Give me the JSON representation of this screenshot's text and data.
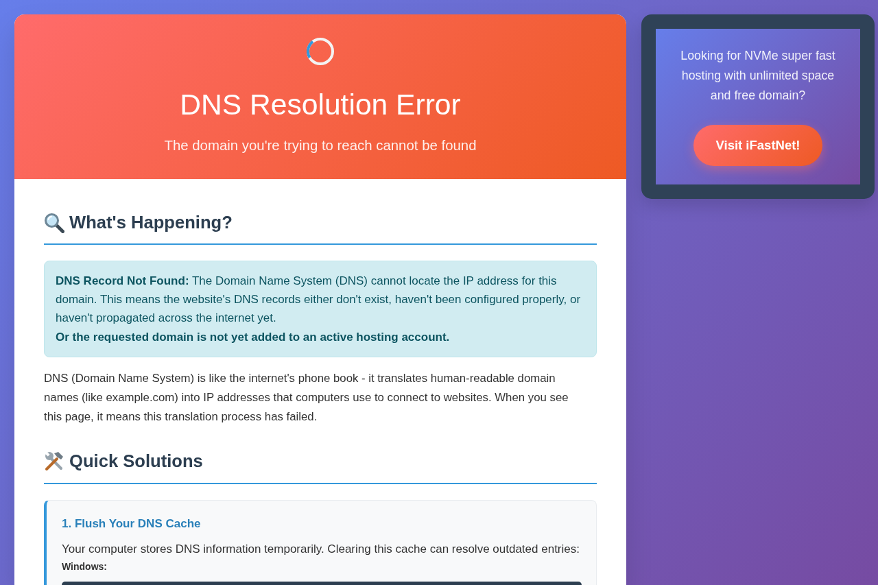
{
  "error_header": {
    "title": "DNS Resolution Error",
    "subtitle": "The domain you're trying to reach cannot be found"
  },
  "whats_happening": {
    "heading": "What's Happening?",
    "alert": {
      "text": "**DNS Record Not Found:** The Domain Name System (DNS) cannot locate the IP address for this domain. This means the website's DNS records either don't exist, haven't been configured properly, or haven't propagated across the internet yet.",
      "note": "Or the requested domain is not yet added to an active hosting account."
    },
    "explanation": "DNS (Domain Name System) is like the internet's phone book - it translates human-readable domain names (like example.com) into IP addresses that computers use to connect to websites. When you see this page, it means this translation process has failed."
  },
  "quick_solutions": {
    "heading": "Quick Solutions",
    "solutions": [
      {
        "title": "1. Flush Your DNS Cache",
        "description": "Your computer stores DNS information temporarily. Clearing this cache can resolve outdated entries:",
        "platform_label": "Windows:"
      }
    ]
  },
  "ad": {
    "text": "Looking for NVMe super fast hosting with unlimited space and free domain?",
    "button": "Visit iFastNet!"
  }
}
